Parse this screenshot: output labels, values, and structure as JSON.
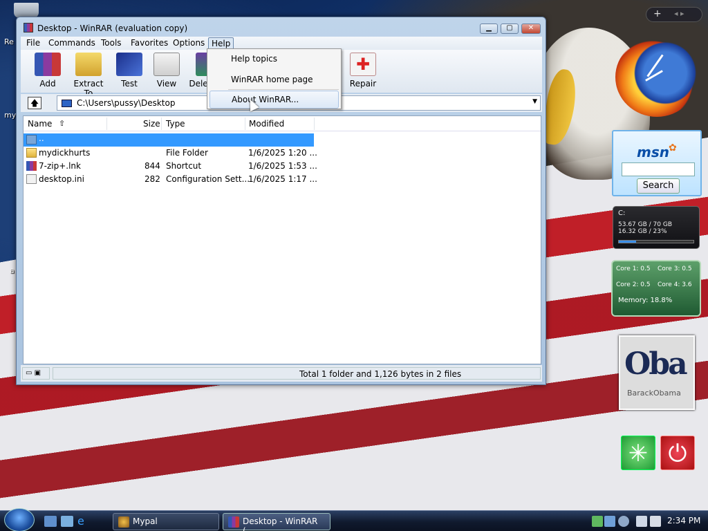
{
  "desktop": {
    "icon_labels": [
      "Re",
      "my",
      "a"
    ],
    "gadgets": {
      "msn": {
        "logo": "msn",
        "search_label": "Search"
      },
      "drive": {
        "drive": "C:",
        "free": "53.67 GB / 70 GB",
        "used": "16.32 GB / 23%",
        "used_fraction": 0.23
      },
      "cpu": {
        "core1": "Core 1: 0.5",
        "core2": "Core 2: 0.5",
        "core3": "Core 3: 0.5",
        "core4": "Core 4: 3.6",
        "memory": "Memory: 18.8%"
      },
      "obama": {
        "big": "Oba",
        "small": "BarackObama"
      }
    }
  },
  "window": {
    "title": "Desktop - WinRAR (evaluation copy)",
    "menus": [
      "File",
      "Commands",
      "Tools",
      "Favorites",
      "Options",
      "Help"
    ],
    "toolbar": [
      "Add",
      "Extract To",
      "Test",
      "View",
      "Dele",
      "Repair"
    ],
    "path": "C:\\Users\\pussy\\Desktop",
    "columns": {
      "name": "Name",
      "size": "Size",
      "type": "Type",
      "modified": "Modified"
    },
    "rows": [
      {
        "name": "..",
        "size": "",
        "type": "",
        "modified": ""
      },
      {
        "name": "mydickhurts",
        "size": "",
        "type": "File Folder",
        "modified": "1/6/2025 1:20 ..."
      },
      {
        "name": "7-zip+.lnk",
        "size": "844",
        "type": "Shortcut",
        "modified": "1/6/2025 1:53 ..."
      },
      {
        "name": "desktop.ini",
        "size": "282",
        "type": "Configuration Sett...",
        "modified": "1/6/2025 1:17 ..."
      }
    ],
    "status": "Total 1 folder and 1,126 bytes in 2 files"
  },
  "help_menu": {
    "items": [
      "Help topics",
      "WinRAR home page",
      "About WinRAR..."
    ]
  },
  "taskbar": {
    "tasks": [
      "Mypal",
      "Desktop - WinRAR (..."
    ],
    "clock": "2:34 PM"
  }
}
